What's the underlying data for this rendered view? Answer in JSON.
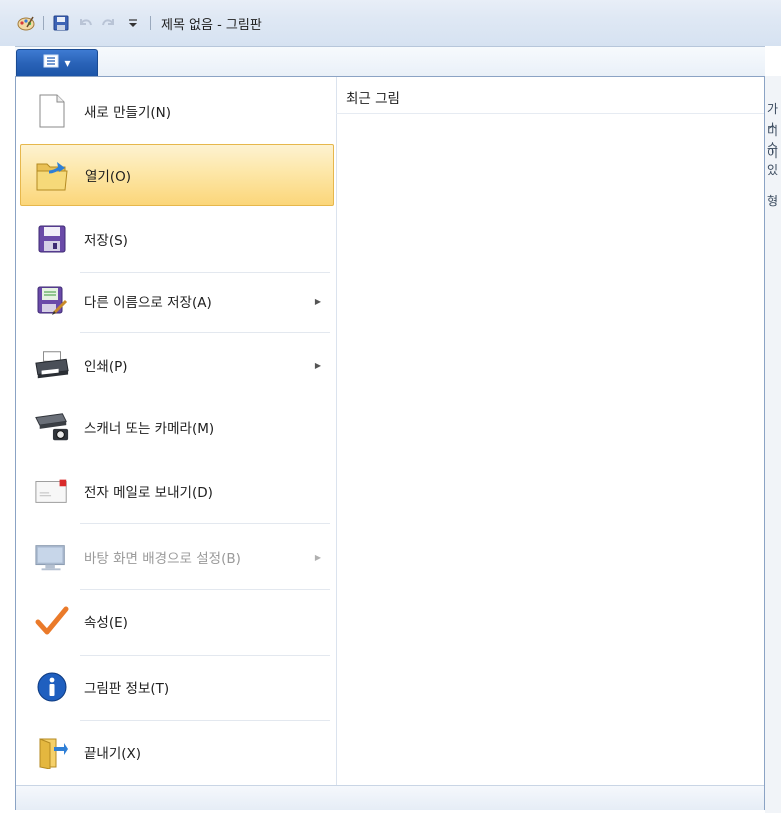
{
  "window": {
    "title": "제목 없음 - 그림판"
  },
  "quick_access": {
    "icons": [
      "paint-app-icon",
      "save-icon",
      "undo-icon",
      "redo-icon",
      "customize-dropdown-icon"
    ]
  },
  "app_button": {
    "icon": "menu-list-icon",
    "arrow": "▾"
  },
  "menu": {
    "items": [
      {
        "label": "새로 만들기(N)",
        "icon": "new-document-icon",
        "submenu": false,
        "state": "normal"
      },
      {
        "label": "열기(O)",
        "icon": "open-folder-icon",
        "submenu": false,
        "state": "selected"
      },
      {
        "label": "저장(S)",
        "icon": "save-icon",
        "submenu": false,
        "state": "normal"
      },
      {
        "label": "다른 이름으로 저장(A)",
        "icon": "save-as-icon",
        "submenu": true,
        "state": "normal"
      },
      {
        "label": "인쇄(P)",
        "icon": "printer-icon",
        "submenu": true,
        "state": "normal"
      },
      {
        "label": "스캐너 또는 카메라(M)",
        "icon": "scanner-camera-icon",
        "submenu": false,
        "state": "normal"
      },
      {
        "label": "전자 메일로 보내기(D)",
        "icon": "email-icon",
        "submenu": false,
        "state": "normal"
      },
      {
        "label": "바탕 화면 배경으로 설정(B)",
        "icon": "desktop-background-icon",
        "submenu": true,
        "state": "disabled"
      },
      {
        "label": "속성(E)",
        "icon": "checkmark-icon",
        "submenu": false,
        "state": "normal"
      },
      {
        "label": "그림판 정보(T)",
        "icon": "info-icon",
        "submenu": false,
        "state": "normal"
      },
      {
        "label": "끝내기(X)",
        "icon": "exit-icon",
        "submenu": false,
        "state": "normal"
      }
    ],
    "submenu_arrow": "▶"
  },
  "recent": {
    "title": "최근 그림"
  },
  "background_fragments": [
    "가 ㅅ",
    "미 수",
    "이 있",
    "형"
  ],
  "colors": {
    "accent": "#2a63b8",
    "selected_bg": "#fde7a8",
    "selected_border": "#e6b74c",
    "disabled_text": "#9a9a9a"
  }
}
